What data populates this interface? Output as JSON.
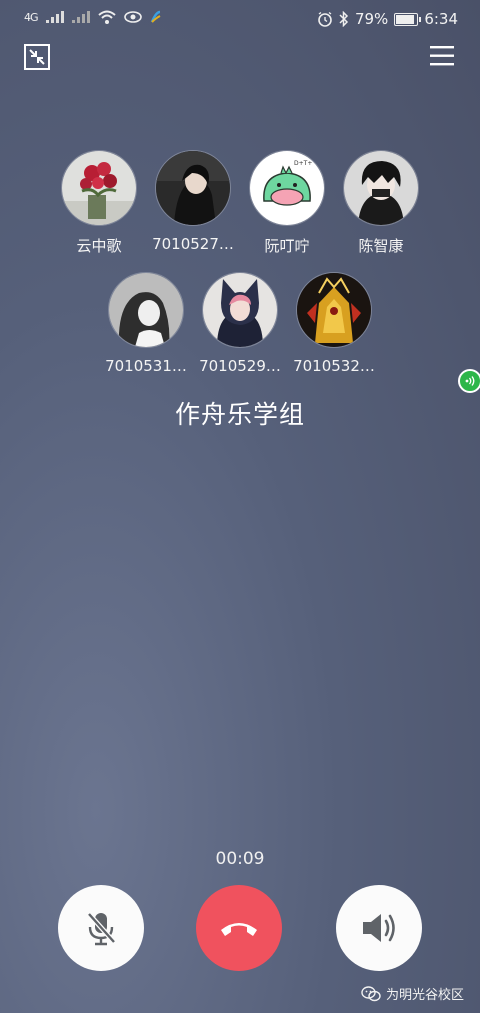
{
  "status_bar": {
    "network": "4G",
    "battery_percent": "79%",
    "battery_level": 0.79,
    "time": "6:34"
  },
  "header": {
    "minimize_icon": "minimize-window-icon",
    "menu_icon": "hamburger-menu-icon"
  },
  "participants": [
    {
      "name": "云中歌",
      "speaking": false
    },
    {
      "name": "7010527…",
      "speaking": true
    },
    {
      "name": "阮叮咛",
      "speaking": false
    },
    {
      "name": "陈智康",
      "speaking": false
    },
    {
      "name": "7010531…",
      "speaking": false
    },
    {
      "name": "7010529…",
      "speaking": false
    },
    {
      "name": "7010532…",
      "speaking": false
    }
  ],
  "group_name": "作舟乐学组",
  "call_duration": "00:09",
  "controls": {
    "mute_icon": "microphone-muted-icon",
    "hangup_icon": "phone-hangup-icon",
    "speaker_icon": "speaker-icon"
  },
  "colors": {
    "hangup": "#f0525e",
    "speaking_indicator": "#2db64a"
  },
  "watermark": "为明光谷校区"
}
